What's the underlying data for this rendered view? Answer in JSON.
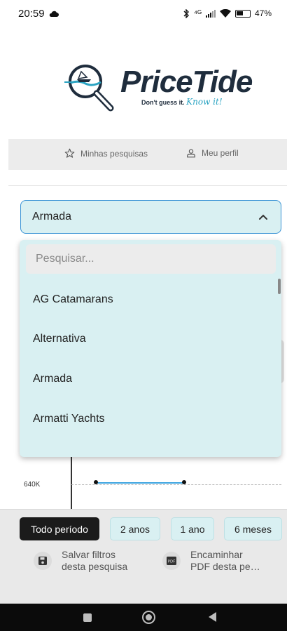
{
  "status_bar": {
    "time": "20:59",
    "signal_text": "⁴ᴳ",
    "battery": "47%"
  },
  "logo": {
    "wordmark": "PriceTide",
    "tagline": "Don't guess it.",
    "tagline_script": "Know it!"
  },
  "nav": {
    "searches_label": "Minhas pesquisas",
    "profile_label": "Meu perfil"
  },
  "select": {
    "value": "Armada"
  },
  "dropdown": {
    "search_placeholder": "Pesquisar...",
    "options": [
      "AG Catamarans",
      "Alternativa",
      "Armada",
      "Armatti Yachts"
    ]
  },
  "chart": {
    "ytick": "640K"
  },
  "periods": {
    "all": "Todo período",
    "two_years": "2 anos",
    "one_year": "1 ano",
    "six_months": "6 meses",
    "active": "all"
  },
  "actions": {
    "save_line1": "Salvar filtros",
    "save_line2": "desta pesquisa",
    "pdf_line1": "Encaminhar",
    "pdf_line2": "PDF desta pe…",
    "pdf_badge": "PDF"
  },
  "colors": {
    "accent": "#3a93d5",
    "select_bg": "#d9f0f2",
    "brand_dark": "#1f2d3d",
    "brand_teal": "#2aa3c2"
  }
}
